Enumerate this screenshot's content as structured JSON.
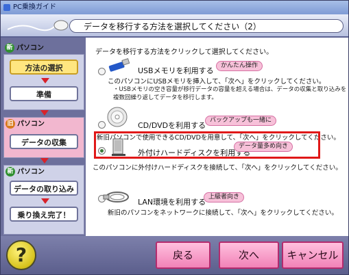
{
  "window": {
    "title": "PC乗換ガイド"
  },
  "header": {
    "title": "データを移行する方法を選択してください（2）"
  },
  "sidebar": {
    "groups": [
      {
        "badge": "新",
        "label": "パソコン"
      },
      {
        "badge": "旧",
        "label": "パソコン"
      },
      {
        "badge": "新",
        "label": "パソコン"
      }
    ],
    "steps": [
      "方法の選択",
      "準備",
      "データの収集",
      "データの取り込み",
      "乗り換え完了！"
    ],
    "active_step": "方法の選択"
  },
  "main": {
    "instruction": "データを移行する方法をクリックして選択してください。",
    "options": [
      {
        "label": "USBメモリを利用する",
        "tag": "かんたん操作",
        "desc": "このパソコンにUSBメモリを挿入して、「次へ」をクリックしてください。",
        "note1": "・USBメモリの空き容量が移行データの容量を超える場合は、データの収集と取り込みを",
        "note2": "複数回繰り返してデータを移行します。"
      },
      {
        "label": "CD/DVDを利用する",
        "tag": "バックアップも一緒に",
        "desc": "新旧パソコンで使用できるCD/DVDを用意して、「次へ」をクリックしてください。"
      },
      {
        "label": "外付けハードディスクを利用する",
        "tag": "データ量多め向き",
        "desc": "このパソコンに外付けハードディスクを接続して、「次へ」をクリックしてください。",
        "selected": true
      },
      {
        "label": "LAN環境を利用する",
        "tag": "上級者向き",
        "desc": "新旧のパソコンをネットワークに接続して、「次へ」をクリックしてください。"
      }
    ]
  },
  "footer": {
    "help": "?",
    "back": "戻る",
    "next": "次へ",
    "cancel": "キャンセル"
  }
}
